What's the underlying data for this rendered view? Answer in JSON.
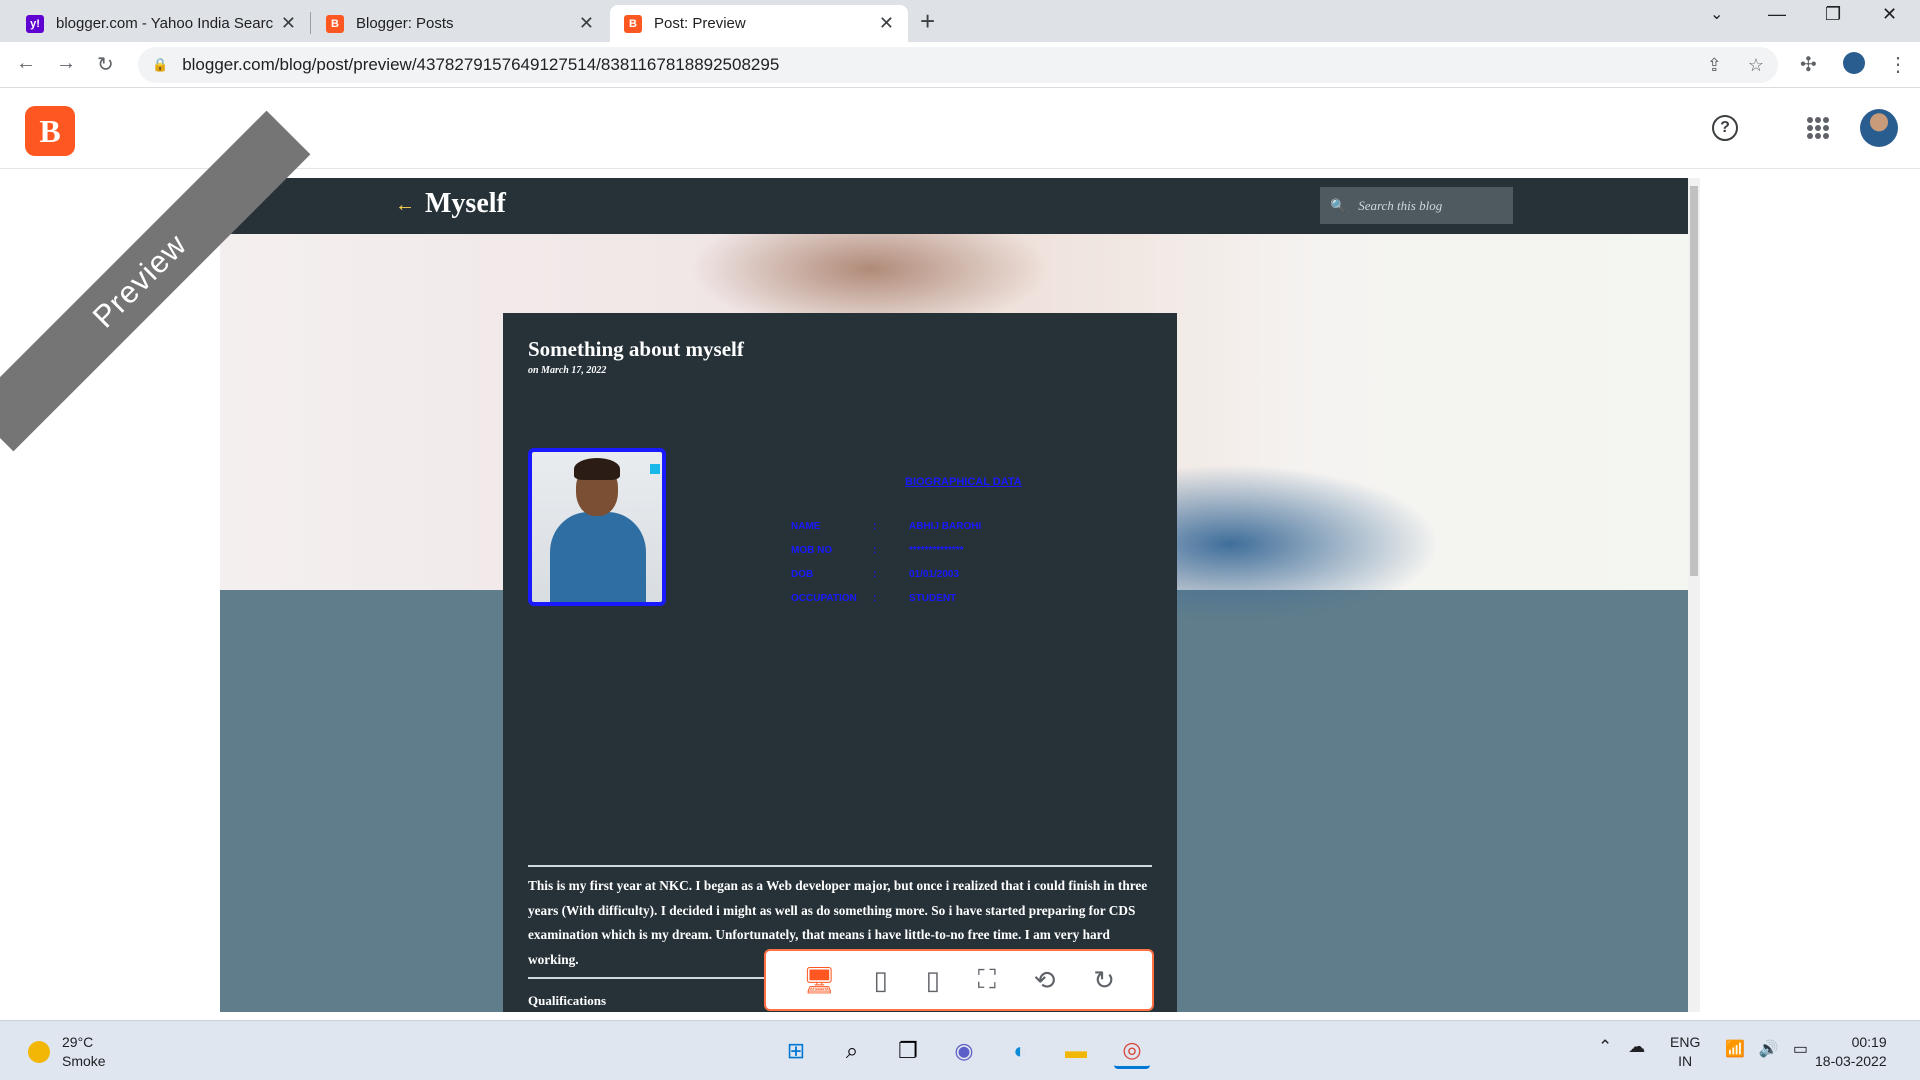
{
  "browser": {
    "tabs": [
      {
        "title": "blogger.com - Yahoo India Searc",
        "favicon": "yahoo-icon",
        "color": "#5f01d1"
      },
      {
        "title": "Blogger: Posts",
        "favicon": "blogger-icon",
        "color": "#ff5722"
      },
      {
        "title": "Post: Preview",
        "favicon": "blogger-icon",
        "color": "#ff5722"
      }
    ],
    "new_tab": "+",
    "url": "blogger.com/blog/post/preview/4378279157649127514/8381167818892508295"
  },
  "blogger": {
    "logo": "B",
    "help": "?"
  },
  "preview": {
    "ribbon": "Preview",
    "blog_title": "Myself",
    "search_placeholder": "Search this blog",
    "post": {
      "title": "Something about myself",
      "date": "on March 17, 2022",
      "info_heading": "BIOGRAPHICAL DATA",
      "info_rows": [
        {
          "label": "NAME",
          "sep": ":",
          "value": "ABHIJ BAROHI"
        },
        {
          "label": "MOB NO",
          "sep": ":",
          "value": "**************"
        },
        {
          "label": "DOB",
          "sep": ":",
          "value": "01/01/2003"
        },
        {
          "label": "OCCUPATION",
          "sep": ":",
          "value": "STUDENT"
        }
      ],
      "body": "This is my first year at NKC. I began as a Web developer major, but once i realized that i could finish in three years (With difficulty). I decided i might as well as do something more. So i have started preparing for CDS examination which is my dream. Unfortunately, that means i have little-to-no free time. I am very hard working.",
      "next_heading": "Qualifications"
    }
  },
  "taskbar": {
    "temp": "29°C",
    "condition": "Smoke",
    "lang1": "ENG",
    "lang2": "IN",
    "time": "00:19",
    "date": "18-03-2022"
  }
}
